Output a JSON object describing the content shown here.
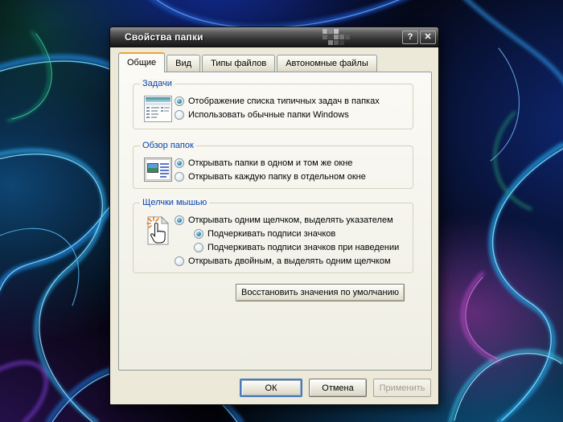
{
  "window": {
    "title": "Свойства папки",
    "help_button": "?",
    "close_button": "✕"
  },
  "tabs": [
    {
      "label": "Общие",
      "active": true
    },
    {
      "label": "Вид",
      "active": false
    },
    {
      "label": "Типы файлов",
      "active": false
    },
    {
      "label": "Автономные файлы",
      "active": false
    }
  ],
  "groups": [
    {
      "label": "Задачи",
      "icon": "tasks-pane-icon",
      "options": [
        {
          "label": "Отображение списка типичных задач в папках",
          "selected": true
        },
        {
          "label": "Использовать обычные папки Windows",
          "selected": false
        }
      ]
    },
    {
      "label": "Обзор папок",
      "icon": "folder-window-icon",
      "options": [
        {
          "label": "Открывать папки в одном и том же окне",
          "selected": true
        },
        {
          "label": "Открывать каждую папку в отдельном окне",
          "selected": false
        }
      ]
    },
    {
      "label": "Щелчки мышью",
      "icon": "single-click-hand-icon",
      "options": [
        {
          "label": "Открывать одним щелчком, выделять указателем",
          "selected": true,
          "indent": false
        },
        {
          "label": "Подчеркивать подписи значков",
          "selected": true,
          "indent": true
        },
        {
          "label": "Подчеркивать подписи значков при наведении",
          "selected": false,
          "indent": true
        },
        {
          "label": "Открывать двойным, а выделять одним щелчком",
          "selected": false,
          "indent": false
        }
      ]
    }
  ],
  "restore_button": "Восстановить значения по умолчанию",
  "footer": {
    "ok": "ОК",
    "cancel": "Отмена",
    "apply": "Применить",
    "apply_disabled": true
  },
  "colors": {
    "dialog_bg": "#ece9d8",
    "tab_highlight_orange": "#efa338",
    "group_label_blue": "#0a46ad",
    "radio_dot_teal": "#2e84a8",
    "ok_focus_ring": "#4879bd",
    "titlebar_top": "#969696",
    "titlebar_bottom": "#161616",
    "wallpaper_base": "#030309"
  }
}
